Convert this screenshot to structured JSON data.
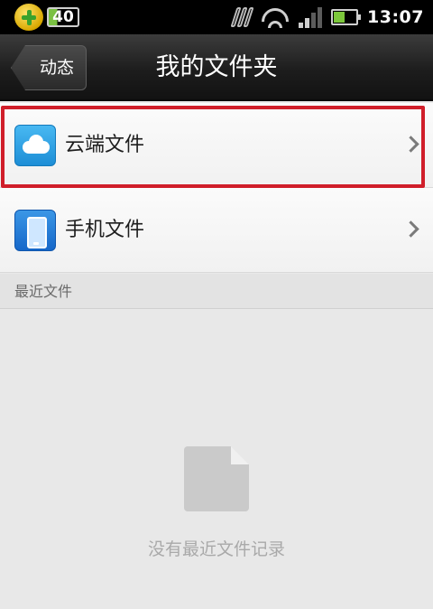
{
  "status_bar": {
    "badge_text": "40",
    "time": "13:07",
    "icons": [
      "plus-app-icon",
      "data-transfer-icon",
      "wifi-icon",
      "signal-icon",
      "battery-icon"
    ],
    "battery_level": 0.45
  },
  "header": {
    "back_label": "动态",
    "title": "我的文件夹"
  },
  "folders": [
    {
      "label": "云端文件",
      "icon": "cloud-icon",
      "highlighted": true
    },
    {
      "label": "手机文件",
      "icon": "phone-icon",
      "highlighted": false
    }
  ],
  "recent": {
    "section_title": "最近文件",
    "empty_message": "没有最近文件记录"
  },
  "colors": {
    "highlight_border": "#d01e2a",
    "title_bar": "#1d1d1d",
    "cloud_icon": "#2aa0e6",
    "phone_icon": "#1d6fd0"
  }
}
